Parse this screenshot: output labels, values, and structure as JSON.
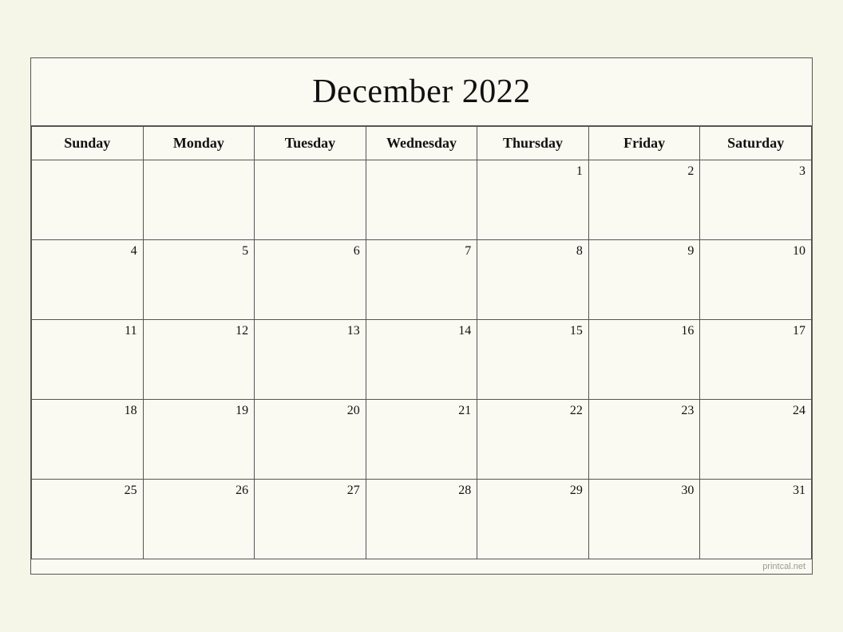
{
  "calendar": {
    "title": "December 2022",
    "watermark": "printcal.net",
    "days_of_week": [
      "Sunday",
      "Monday",
      "Tuesday",
      "Wednesday",
      "Thursday",
      "Friday",
      "Saturday"
    ],
    "weeks": [
      [
        null,
        null,
        null,
        null,
        1,
        2,
        3
      ],
      [
        4,
        5,
        6,
        7,
        8,
        9,
        10
      ],
      [
        11,
        12,
        13,
        14,
        15,
        16,
        17
      ],
      [
        18,
        19,
        20,
        21,
        22,
        23,
        24
      ],
      [
        25,
        26,
        27,
        28,
        29,
        30,
        31
      ]
    ]
  }
}
